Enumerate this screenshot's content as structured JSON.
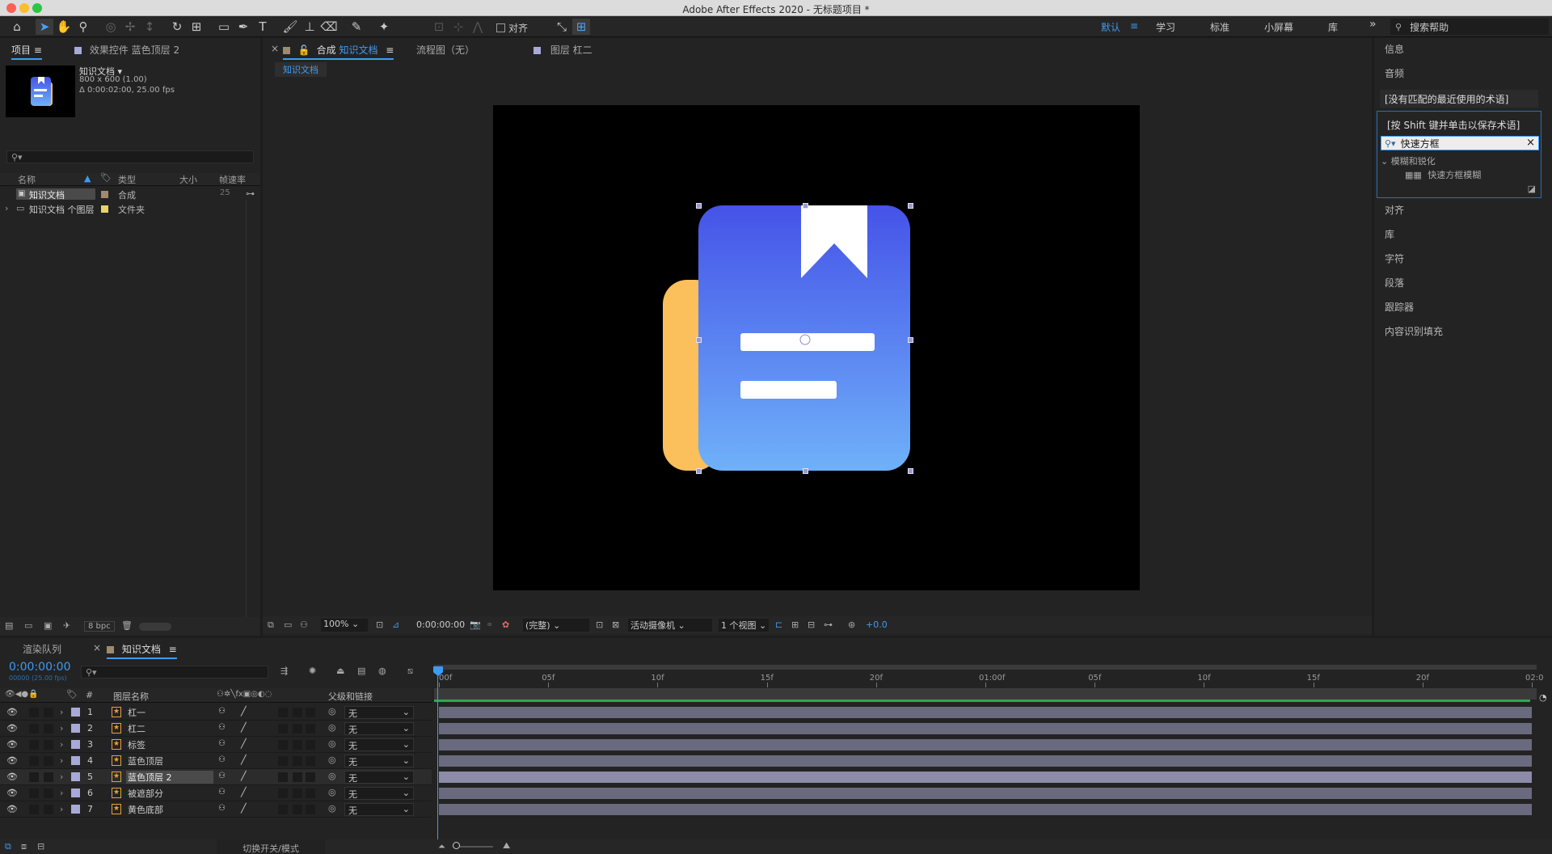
{
  "app": {
    "title": "Adobe After Effects 2020 - 无标题项目 *"
  },
  "toolbar": {
    "align_label": "对齐",
    "workspaces": [
      "默认",
      "学习",
      "标准",
      "小屏幕",
      "库"
    ],
    "search_placeholder": "搜索帮助"
  },
  "project_panel": {
    "tab_project": "项目",
    "tab_effects": "效果控件 蓝色顶层 2",
    "selected_name": "知识文档 ▾",
    "selected_size": "800 x 600 (1.00)",
    "selected_duration": "Δ 0:00:02:00, 25.00 fps",
    "columns": [
      "名称",
      "类型",
      "大小",
      "帧速率"
    ],
    "items": [
      {
        "name": "知识文档",
        "type": "合成",
        "size": "",
        "fps": "25",
        "color": "#a08a6e"
      },
      {
        "name": "知识文档 个图层",
        "type": "文件夹",
        "size": "",
        "fps": "",
        "color": "#e8d36a"
      }
    ],
    "bpc": "8 bpc"
  },
  "viewer": {
    "tab_comp_prefix": "合成",
    "tab_comp_name": "知识文档",
    "tab_flowchart": "流程图（无）",
    "tab_layer": "图层 杠二",
    "breadcrumb": "知识文档",
    "zoom": "100%",
    "timecode": "0:00:00:00",
    "resolution": "(完整)",
    "camera": "活动摄像机",
    "views": "1 个视图",
    "exposure": "+0.0"
  },
  "right_panel": {
    "info": "信息",
    "audio": "音频",
    "no_match": "[没有匹配的最近使用的术语]",
    "shift_hint": "[按 Shift 键并单击以保存术语]",
    "search_value": "快速方框",
    "category": "模糊和锐化",
    "effect": "快速方框模糊",
    "panels": [
      "对齐",
      "库",
      "字符",
      "段落",
      "跟踪器",
      "内容识别填充"
    ]
  },
  "timeline": {
    "tab_render": "渲染队列",
    "tab_comp": "知识文档",
    "timecode": "0:00:00:00",
    "frame_info": "00000 (25.00 fps)",
    "col_num": "#",
    "col_layer_name": "图层名称",
    "col_parent": "父级和链接",
    "ruler": [
      "00f",
      "05f",
      "10f",
      "15f",
      "20f",
      "01:00f",
      "05f",
      "10f",
      "15f",
      "20f",
      "02:0"
    ],
    "layers": [
      {
        "num": "1",
        "name": "杠一",
        "parent": "无"
      },
      {
        "num": "2",
        "name": "杠二",
        "parent": "无"
      },
      {
        "num": "3",
        "name": "标签",
        "parent": "无"
      },
      {
        "num": "4",
        "name": "蓝色顶层",
        "parent": "无"
      },
      {
        "num": "5",
        "name": "蓝色顶层 2",
        "parent": "无"
      },
      {
        "num": "6",
        "name": "被遮部分",
        "parent": "无"
      },
      {
        "num": "7",
        "name": "黄色底部",
        "parent": "无"
      }
    ],
    "toggle_label": "切换开关/模式"
  },
  "colors": {
    "accent": "#3d9bf5",
    "layer_label": "#a9a9d8",
    "icon_blue_top": "#4553e8",
    "icon_blue_bottom": "#6fb1f9",
    "icon_yellow": "#fbbf5b"
  }
}
